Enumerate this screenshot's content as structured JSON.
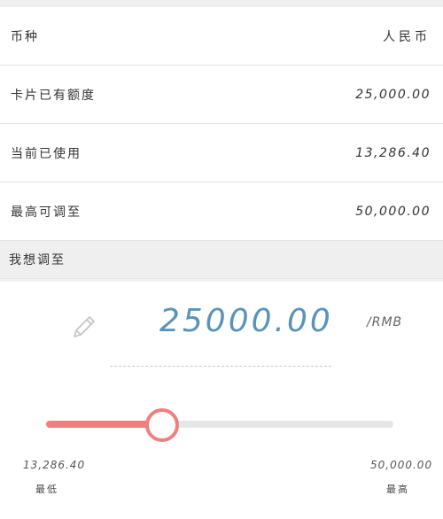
{
  "rows": [
    {
      "label": "币种",
      "value": "人民币"
    },
    {
      "label": "卡片已有额度",
      "value": "25,000.00"
    },
    {
      "label": "当前已使用",
      "value": "13,286.40"
    },
    {
      "label": "最高可调至",
      "value": "50,000.00"
    }
  ],
  "section": {
    "title": "我想调至"
  },
  "adjust": {
    "amount": "25000.00",
    "unit": "/RMB",
    "icon": "pencil-icon"
  },
  "slider": {
    "min_value": "13,286.40",
    "min_caption": "最低",
    "max_value": "50,000.00",
    "max_caption": "最高",
    "position_fraction": 0.335
  },
  "colors": {
    "accent": "#f07f7f",
    "amount": "#5b93b8",
    "track": "#e6e6e6"
  }
}
